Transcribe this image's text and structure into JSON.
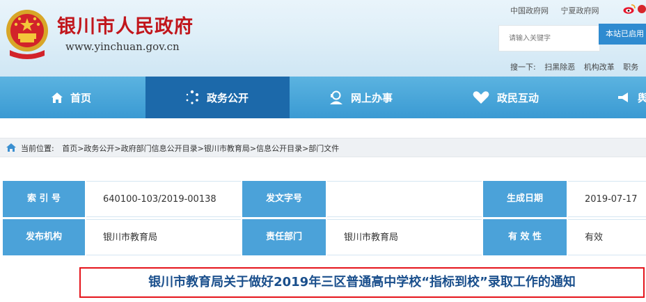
{
  "header": {
    "title": "银川市人民政府",
    "url": "www.yinchuan.gov.cn",
    "top_links": [
      "中国政府网",
      "宁夏政府网"
    ],
    "search": {
      "placeholder": "请输入关键字",
      "button_label": "本站已启用"
    },
    "hot_words_label": "搜一下:",
    "hot_words": [
      "扫黑除恶",
      "机构改革",
      "职务"
    ]
  },
  "nav": {
    "items": [
      {
        "label": "首页",
        "icon": "home-icon"
      },
      {
        "label": "政务公开",
        "icon": "dots-circle-icon",
        "active": true
      },
      {
        "label": "网上办事",
        "icon": "person-service-icon"
      },
      {
        "label": "政民互动",
        "icon": "heart-hands-icon"
      },
      {
        "label": "舆",
        "icon": "megaphone-icon"
      }
    ]
  },
  "breadcrumb": {
    "label": "当前位置:",
    "path": "首页>政务公开>政府部门信息公开目录>银川市教育局>信息公开目录>部门文件"
  },
  "meta": {
    "index_no_label": "索 引 号",
    "index_no": "640100-103/2019-00138",
    "doc_no_label": "发文字号",
    "doc_no": "",
    "date_label": "生成日期",
    "date": "2019-07-17",
    "publisher_label": "发布机构",
    "publisher": "银川市教育局",
    "dept_label": "责任部门",
    "dept": "银川市教育局",
    "validity_label": "有 效 性",
    "validity": "有效"
  },
  "article": {
    "title": "银川市教育局关于做好2019年三区普通高中学校“指标到校”录取工作的通知"
  },
  "colors": {
    "brand_red": "#c1161c",
    "nav_blue": "#3a9ad3",
    "nav_active": "#1c69aa",
    "label_blue": "#4ba2d9",
    "title_blue": "#1a4f8c",
    "title_border": "#e5141b"
  }
}
